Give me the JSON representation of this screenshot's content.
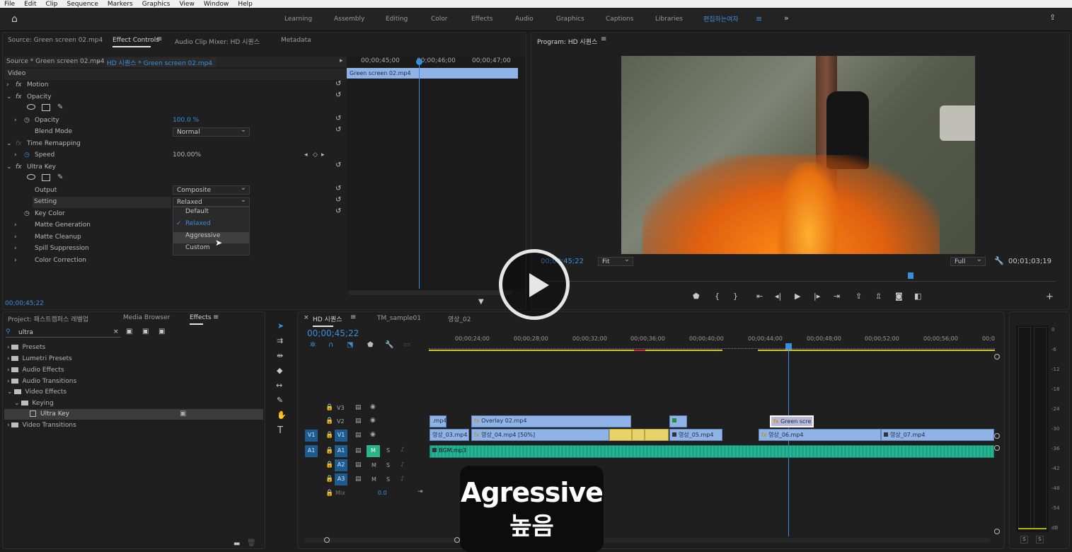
{
  "menu": [
    "File",
    "Edit",
    "Clip",
    "Sequence",
    "Markers",
    "Graphics",
    "View",
    "Window",
    "Help"
  ],
  "workspaces": [
    "Learning",
    "Assembly",
    "Editing",
    "Color",
    "Effects",
    "Audio",
    "Graphics",
    "Captions",
    "Libraries",
    "편집하는여자"
  ],
  "effect_controls": {
    "tabs": [
      "Source: Green screen 02.mp4",
      "Effect Controls",
      "Audio Clip Mixer: HD 시퀀스",
      "Metadata"
    ],
    "source_label": "Source * Green screen 02.mp4",
    "sequence_label": "HD 시퀀스 * Green screen 02.mp4",
    "timecodes": [
      "00;00;45;00",
      "00;00;46;00",
      "00;00;47;00"
    ],
    "clip_name": "Green screen 02.mp4",
    "section_video": "Video",
    "motion": "Motion",
    "opacity": "Opacity",
    "opacity_label": "Opacity",
    "opacity_value": "100.0 %",
    "blend_mode_label": "Blend Mode",
    "blend_mode_value": "Normal",
    "time_remapping": "Time Remapping",
    "speed_label": "Speed",
    "speed_value": "100.00%",
    "ultra_key": "Ultra Key",
    "output_label": "Output",
    "output_value": "Composite",
    "setting_label": "Setting",
    "setting_value": "Relaxed",
    "key_color": "Key Color",
    "matte_generation": "Matte Generation",
    "matte_cleanup": "Matte Cleanup",
    "spill_suppression": "Spill Suppression",
    "color_correction": "Color Correction",
    "dropdown_options": [
      "Default",
      "Relaxed",
      "Aggressive",
      "Custom"
    ],
    "current_time": "00;00;45;22"
  },
  "program": {
    "title": "Program: HD 시퀀스",
    "timecode": "00;00;45;22",
    "fit": "Fit",
    "quality": "Full",
    "duration": "00;01;03;19"
  },
  "project": {
    "tabs": [
      "Project: 패스트캠퍼스 레벨업",
      "Media Browser",
      "Effects"
    ],
    "search_value": "ultra",
    "tree": [
      "Presets",
      "Lumetri Presets",
      "Audio Effects",
      "Audio Transitions",
      "Video Effects",
      "Keying",
      "Ultra Key",
      "Video Transitions"
    ]
  },
  "timeline": {
    "tabs": [
      "HD 시퀀스",
      "TM_sample01",
      "영상_02"
    ],
    "timecode": "00;00;45;22",
    "ruler": [
      "00;00;24;00",
      "00;00;28;00",
      "00;00;32;00",
      "00;00;36;00",
      "00;00;40;00",
      "00;00;44;00",
      "00;00;48;00",
      "00;00;52;00",
      "00;00;56;00",
      "00;0"
    ],
    "tracks": [
      "V3",
      "V2",
      "V1",
      "A1",
      "A2",
      "A3"
    ],
    "mix_label": "Mix",
    "mix_value": "0.0",
    "clips": {
      "v2_a": ".mp4",
      "v2_b": "Overlay 02.mp4",
      "v2_c": "Green scre",
      "v1_a": "영상_03.mp4",
      "v1_b": "영상_04.mp4 [50%]",
      "v1_c": "영상_05.mp4",
      "v1_d": "영상_06.mp4",
      "v1_e": "영상_07.mp4",
      "a1": "BGM.mp3"
    }
  },
  "meter_scale": [
    "0",
    "-6",
    "-12",
    "-18",
    "-24",
    "-30",
    "-36",
    "-42",
    "-48",
    "-54",
    "dB"
  ],
  "meter_buttons": [
    "S",
    "S"
  ],
  "caption": {
    "line1": "Agressive",
    "line2": "높음"
  }
}
